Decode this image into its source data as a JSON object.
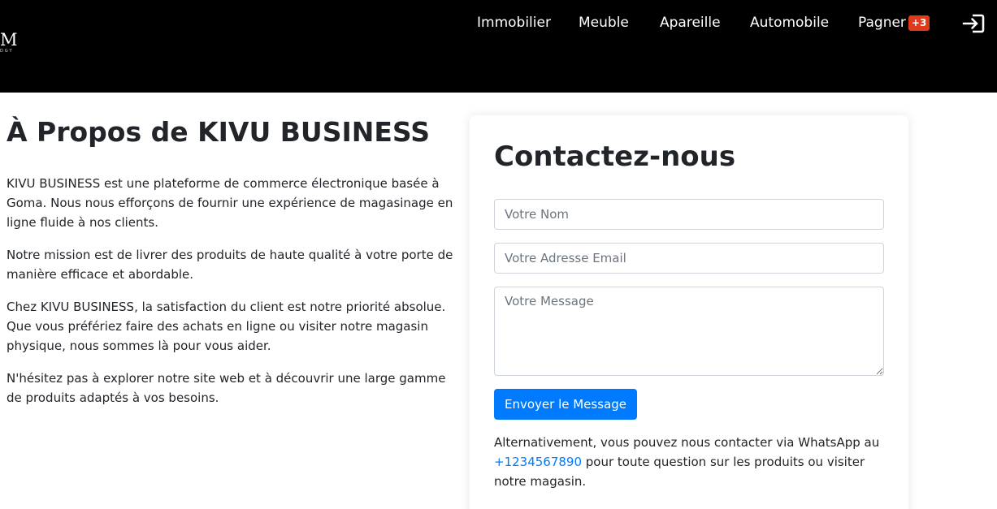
{
  "brand": {
    "logo_letter": "M",
    "logo_sub": "DGY"
  },
  "nav": {
    "items": [
      {
        "label": "Immobilier"
      },
      {
        "label": "Meuble"
      },
      {
        "label": "Apareille"
      },
      {
        "label": "Automobile"
      }
    ],
    "cart_label": "Pagner",
    "cart_badge": "+3",
    "login_icon": "sign-in-icon"
  },
  "about": {
    "title": "À Propos de KIVU BUSINESS",
    "paragraphs": [
      "KIVU BUSINESS est une plateforme de commerce électronique basée à Goma. Nous nous efforçons de fournir une expérience de magasinage en ligne fluide à nos clients.",
      "Notre mission est de livrer des produits de haute qualité à votre porte de manière efficace et abordable.",
      "Chez KIVU BUSINESS, la satisfaction du client est notre priorité absolue. Que vous préfériez faire des achats en ligne ou visiter notre magasin physique, nous sommes là pour vous aider.",
      "N'hésitez pas à explorer notre site web et à découvrir une large gamme de produits adaptés à vos besoins."
    ]
  },
  "contact": {
    "title": "Contactez-nous",
    "name_placeholder": "Votre Nom",
    "name_value": "",
    "email_placeholder": "Votre Adresse Email",
    "email_value": "",
    "message_placeholder": "Votre Message",
    "message_value": "",
    "submit_label": "Envoyer le Message",
    "alt_before": "Alternativement, vous pouvez nous contacter via WhatsApp au ",
    "phone": "+1234567890",
    "alt_after": " pour toute question sur les produits ou visiter notre magasin."
  },
  "colors": {
    "header_bg": "#000000",
    "primary": "#007bff",
    "badge": "#e03a1a",
    "text": "#212529"
  }
}
